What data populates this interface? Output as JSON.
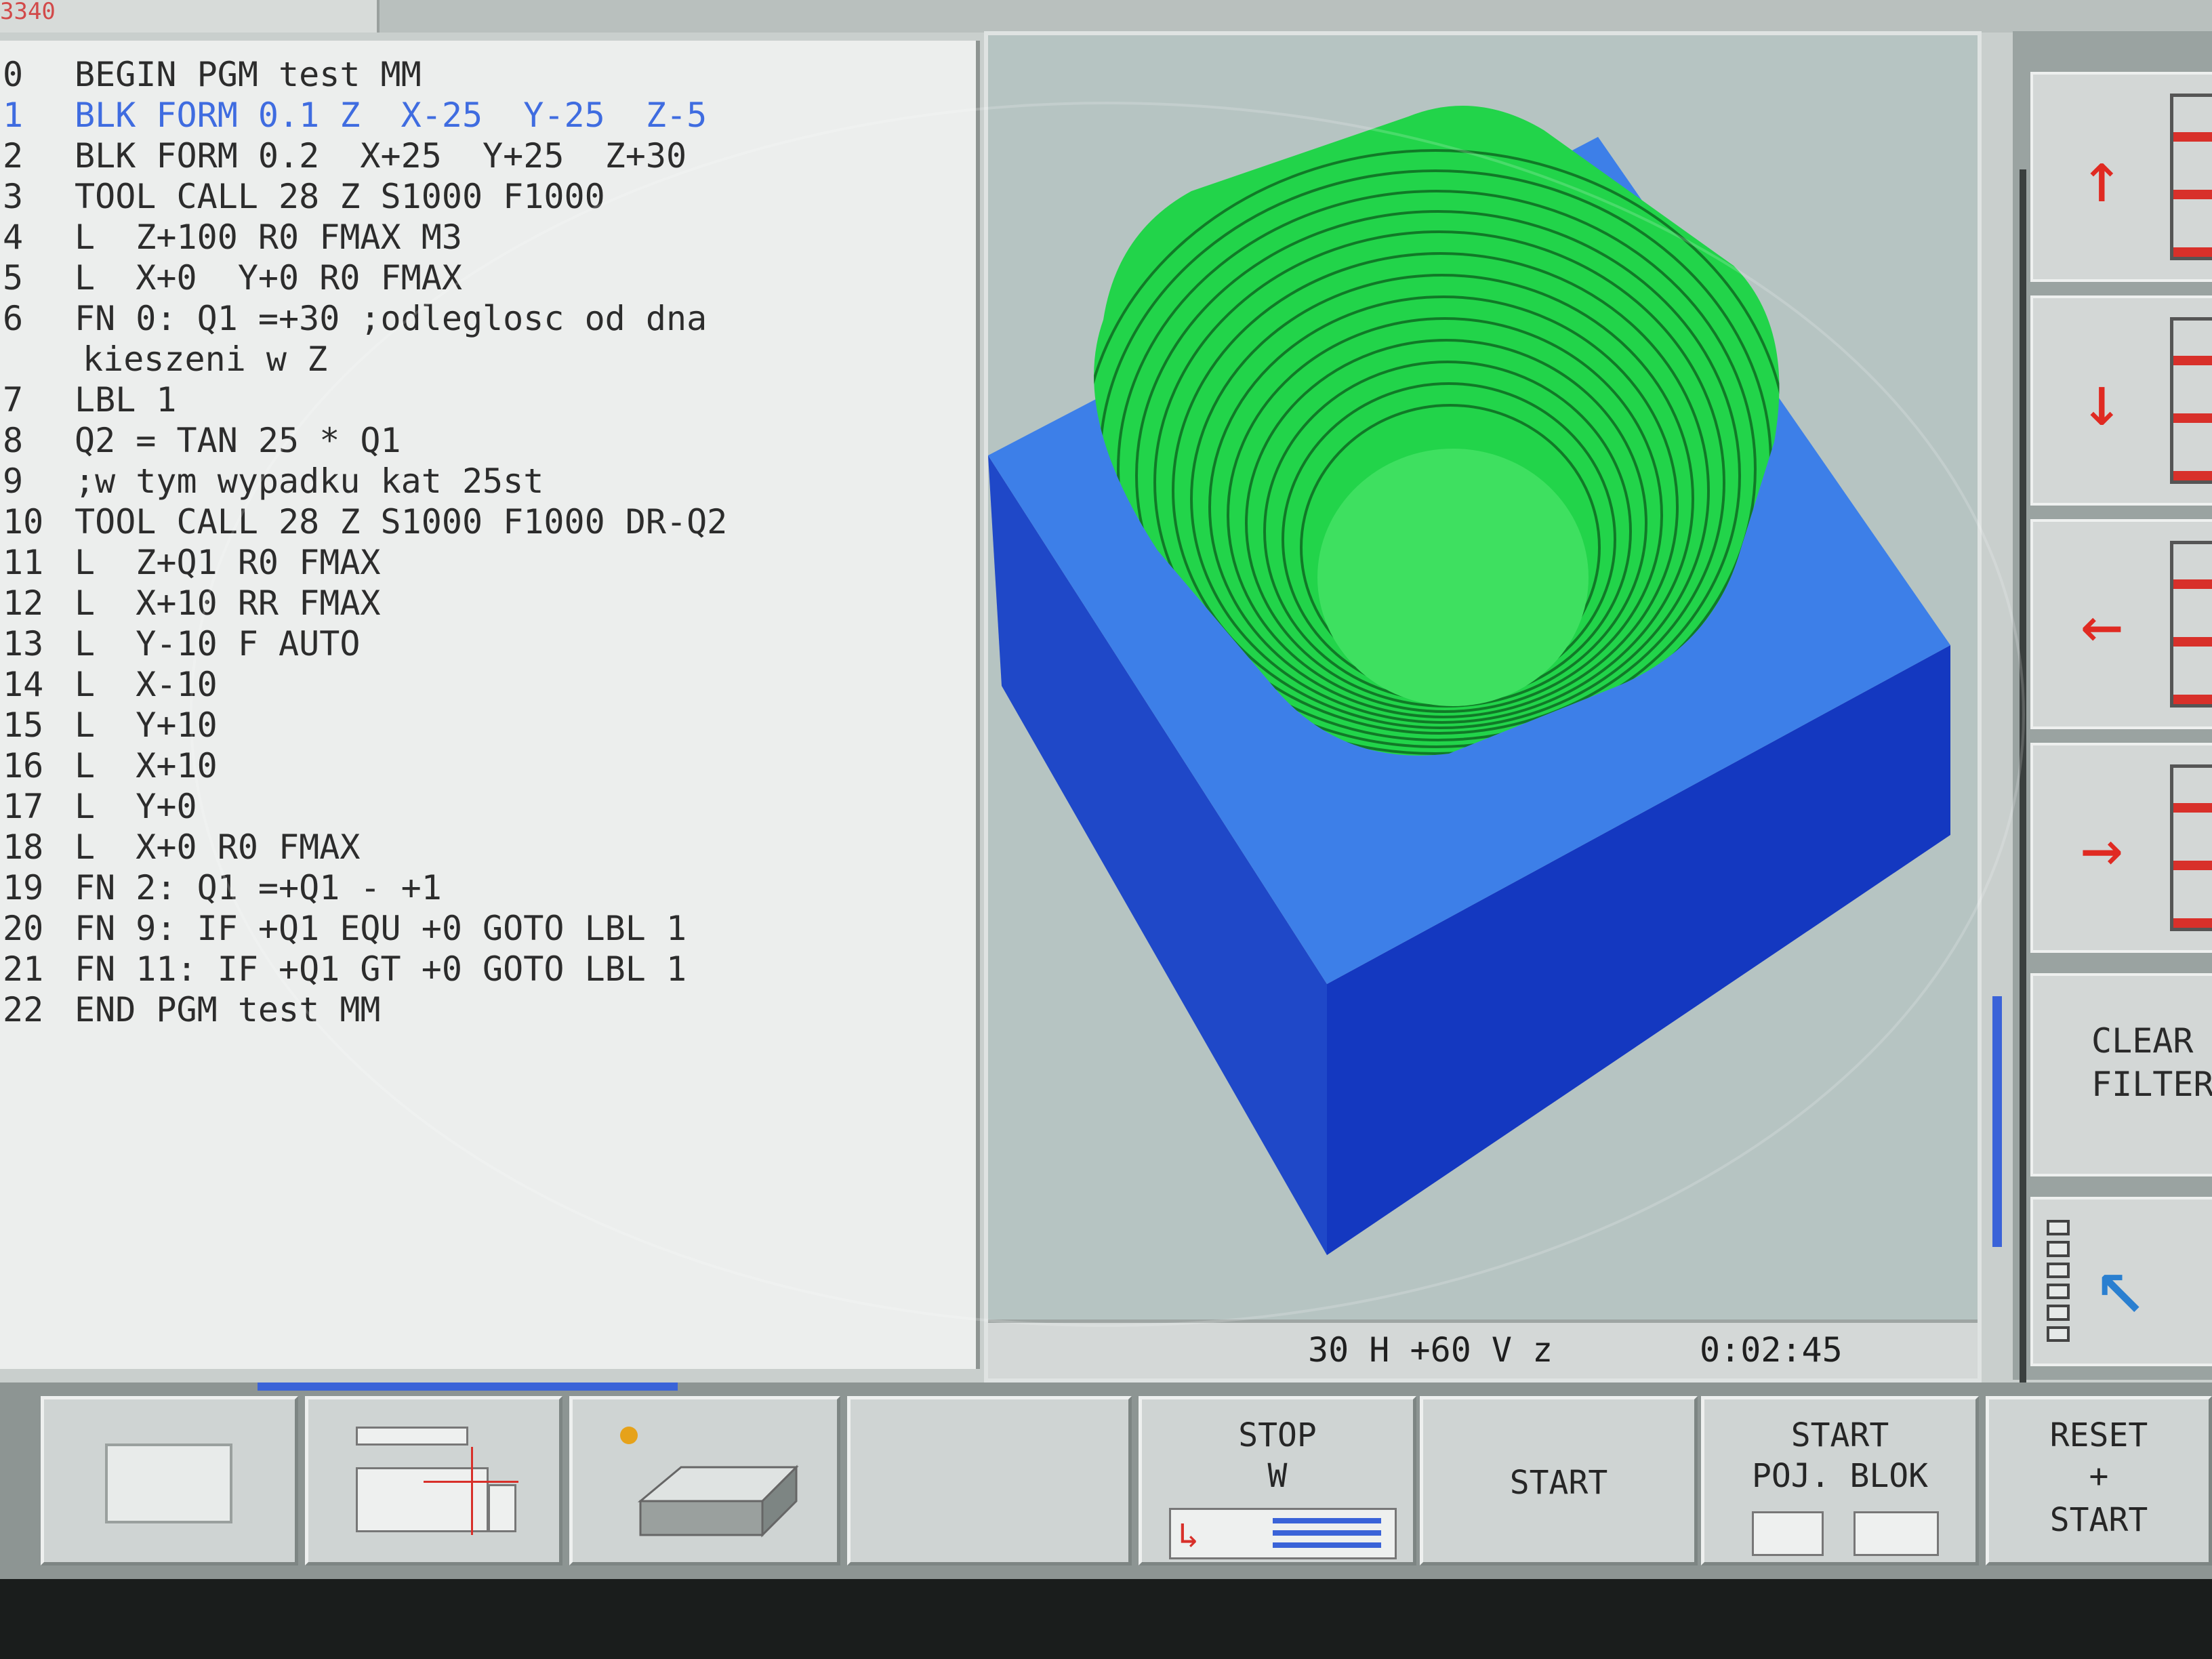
{
  "header": {
    "corner_text": "3340"
  },
  "program": {
    "lines": [
      {
        "n": "0",
        "code": "BEGIN PGM test MM"
      },
      {
        "n": "1",
        "code": "BLK FORM 0.1 Z  X-25  Y-25  Z-5",
        "active": true
      },
      {
        "n": "2",
        "code": "BLK FORM 0.2  X+25  Y+25  Z+30"
      },
      {
        "n": "3",
        "code": "TOOL CALL 28 Z S1000 F1000"
      },
      {
        "n": "4",
        "code": "L  Z+100 R0 FMAX M3"
      },
      {
        "n": "5",
        "code": "L  X+0  Y+0 R0 FMAX"
      },
      {
        "n": "6",
        "code": "FN 0: Q1 =+30 ;odleglosc od dna"
      },
      {
        "n": "",
        "code": "kieszeni w Z",
        "wrap": true
      },
      {
        "n": "7",
        "code": "LBL 1"
      },
      {
        "n": "8",
        "code": "Q2 = TAN 25 * Q1"
      },
      {
        "n": "9",
        "code": ";w tym wypadku kat 25st"
      },
      {
        "n": "10",
        "code": "TOOL CALL 28 Z S1000 F1000 DR-Q2"
      },
      {
        "n": "11",
        "code": "L  Z+Q1 R0 FMAX"
      },
      {
        "n": "12",
        "code": "L  X+10 RR FMAX"
      },
      {
        "n": "13",
        "code": "L  Y-10 F AUTO"
      },
      {
        "n": "14",
        "code": "L  X-10"
      },
      {
        "n": "15",
        "code": "L  Y+10"
      },
      {
        "n": "16",
        "code": "L  X+10"
      },
      {
        "n": "17",
        "code": "L  Y+0"
      },
      {
        "n": "18",
        "code": "L  X+0 R0 FMAX"
      },
      {
        "n": "19",
        "code": "FN 2: Q1 =+Q1 - +1"
      },
      {
        "n": "20",
        "code": "FN 9: IF +Q1 EQU +0 GOTO LBL 1"
      },
      {
        "n": "21",
        "code": "FN 11: IF +Q1 GT +0 GOTO LBL 1"
      },
      {
        "n": "22",
        "code": "END PGM test MM"
      }
    ]
  },
  "graphics": {
    "status": {
      "view_angles": "30 H +60 V z",
      "time": "0:02:45"
    },
    "colors": {
      "workpiece_top": "#3d7fe8",
      "workpiece_side_left": "#1f48c8",
      "workpiece_side_right": "#1438c0",
      "pocket": "#22d44a",
      "background": "#b6c4c2"
    }
  },
  "right_softkeys": [
    {
      "icon": "arrow-up-icon",
      "glyph": "↑"
    },
    {
      "icon": "arrow-down-icon",
      "glyph": "↓"
    },
    {
      "icon": "arrow-left-icon",
      "glyph": "←"
    },
    {
      "icon": "arrow-right-icon",
      "glyph": "→"
    },
    {
      "label": "CLEAR\nFILTER"
    },
    {
      "icon": "pointer-arrow-icon",
      "glyph": "↖"
    }
  ],
  "bottom_softkeys": [
    {
      "icon": "blank-window-icon",
      "label": ""
    },
    {
      "icon": "plan-view-icon",
      "label": ""
    },
    {
      "icon": "3d-view-icon",
      "label": ""
    },
    {
      "label": ""
    },
    {
      "label_line1": "STOP",
      "label_line2": "W",
      "icon": "stop-program-icon"
    },
    {
      "label": "START"
    },
    {
      "label_line1": "START",
      "label_line2": "POJ. BLOK",
      "icon": "single-block-icon"
    },
    {
      "label_line1": "RESET",
      "label_line2": "+",
      "label_line3": "START"
    }
  ]
}
